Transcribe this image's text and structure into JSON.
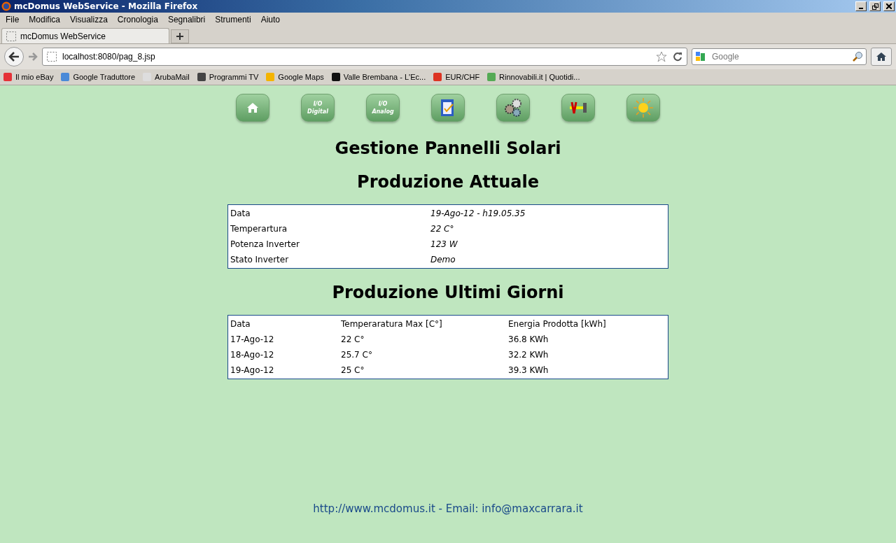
{
  "window": {
    "title": "mcDomus WebService - Mozilla Firefox"
  },
  "menu": [
    "File",
    "Modifica",
    "Visualizza",
    "Cronologia",
    "Segnalibri",
    "Strumenti",
    "Aiuto"
  ],
  "tabs": [
    {
      "label": "mcDomus WebService",
      "selected": true
    }
  ],
  "address": {
    "value": "localhost:8080/pag_8.jsp"
  },
  "search": {
    "placeholder": "Google"
  },
  "bookmarks": [
    {
      "label": "Il mio eBay",
      "kind": "ebay"
    },
    {
      "label": "Google Traduttore",
      "kind": "translate"
    },
    {
      "label": "ArubaMail",
      "kind": "mail"
    },
    {
      "label": "Programmi TV",
      "kind": "tv"
    },
    {
      "label": "Google Maps",
      "kind": "maps"
    },
    {
      "label": "Valle Brembana - L'Ec...",
      "kind": "letter"
    },
    {
      "label": "EUR/CHF",
      "kind": "number"
    },
    {
      "label": "Rinnovabili.it | Quotidi...",
      "kind": "leaf"
    }
  ],
  "nav_buttons": [
    {
      "kind": "home"
    },
    {
      "kind": "text",
      "lines": [
        "I/O",
        "Digital"
      ]
    },
    {
      "kind": "text",
      "lines": [
        "I/O",
        "Analog"
      ]
    },
    {
      "kind": "clipboard"
    },
    {
      "kind": "gears"
    },
    {
      "kind": "tools"
    },
    {
      "kind": "sun"
    }
  ],
  "title": "Gestione Pannelli Solari",
  "current": {
    "heading": "Produzione Attuale",
    "rows": [
      {
        "label": "Data",
        "value": "19-Ago-12 - h19.05.35"
      },
      {
        "label": "Temperartura",
        "value": "22 C°"
      },
      {
        "label": "Potenza Inverter",
        "value": "123 W"
      },
      {
        "label": "Stato Inverter",
        "value": "Demo"
      }
    ]
  },
  "history": {
    "heading": "Produzione Ultimi Giorni",
    "columns": [
      "Data",
      "Temperaratura Max [C°]",
      "Energia Prodotta [kWh]"
    ],
    "rows": [
      [
        "17-Ago-12",
        "22 C°",
        "36.8 KWh"
      ],
      [
        "18-Ago-12",
        "25.7 C°",
        "32.2 KWh"
      ],
      [
        "19-Ago-12",
        "25 C°",
        "39.3 KWh"
      ]
    ]
  },
  "footer": {
    "site": "http://www.mcdomus.it",
    "separator": " - Email: ",
    "email": "info@maxcarrara.it"
  }
}
